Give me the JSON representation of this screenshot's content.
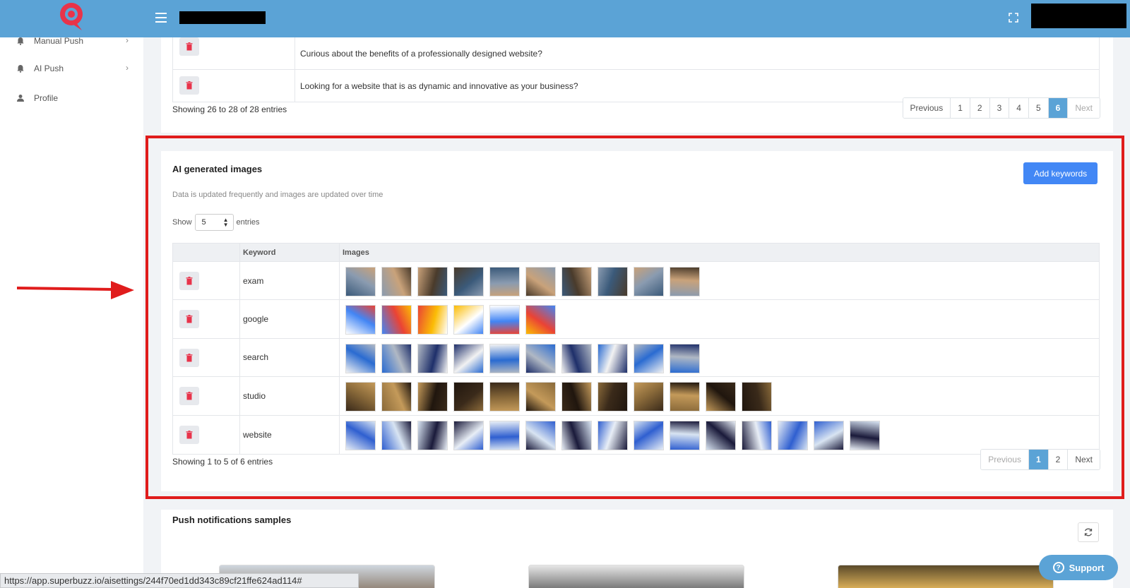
{
  "sidebar": {
    "items": [
      {
        "label": "Manual Push",
        "chevron": "›"
      },
      {
        "label": "AI Push",
        "chevron": "›"
      },
      {
        "label": "Profile"
      }
    ]
  },
  "messages_table": {
    "rows": [
      {
        "text": "Curious about the benefits of a professionally designed website?"
      },
      {
        "text": "Looking for a website that is as dynamic and innovative as your business?"
      }
    ],
    "showing": "Showing 26 to 28 of 28 entries",
    "pagination": [
      "Previous",
      "1",
      "2",
      "3",
      "4",
      "5",
      "6",
      "Next"
    ],
    "active_page": "6"
  },
  "ai_images": {
    "title": "AI generated images",
    "subtitle": "Data is updated frequently and images are updated over time",
    "add_button": "Add keywords",
    "show_label": "Show",
    "entries_value": "5",
    "entries_label": "entries",
    "columns": [
      "Keyword",
      "Images"
    ],
    "rows": [
      {
        "keyword": "exam",
        "image_count": 10
      },
      {
        "keyword": "google",
        "image_count": 6
      },
      {
        "keyword": "search",
        "image_count": 10
      },
      {
        "keyword": "studio",
        "image_count": 12
      },
      {
        "keyword": "website",
        "image_count": 15
      }
    ],
    "showing": "Showing 1 to 5 of 6 entries",
    "pagination": [
      "Previous",
      "1",
      "2",
      "Next"
    ],
    "active_page": "1"
  },
  "push_samples": {
    "title": "Push notifications samples"
  },
  "status_url": "https://app.superbuzz.io/aisettings/244f70ed1dd343c89cf21ffe624ad114#",
  "support_label": "Support",
  "colors": {
    "topbar": "#5ba3d6",
    "primary_button": "#4287f5",
    "highlight": "#e01c1c",
    "logo": "#e8334a"
  }
}
